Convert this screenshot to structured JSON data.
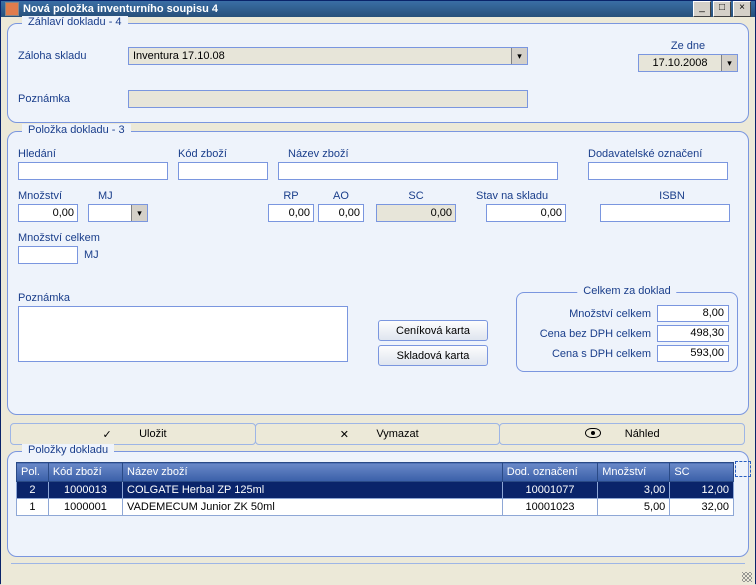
{
  "window": {
    "title": "Nová položka inventurního soupisu 4"
  },
  "header": {
    "legend": "Záhlaví dokladu - 4",
    "storageBackupLabel": "Záloha skladu",
    "storageBackupValue": "Inventura 17.10.08",
    "dateLabel": "Ze dne",
    "dateValue": "17.10.2008",
    "noteLabel": "Poznámka",
    "noteValue": ""
  },
  "item": {
    "legend": "Položka dokladu - 3",
    "searchLabel": "Hledání",
    "searchValue": "",
    "codeLabel": "Kód zboží",
    "codeValue": "",
    "nameLabel": "Název zboží",
    "nameValue": "",
    "supplierLabel": "Dodavatelské označení",
    "supplierValue": "",
    "qtyLabel": "Množství",
    "qtyValue": "0,00",
    "mjLabel": "MJ",
    "mjValue": "",
    "rpLabel": "RP",
    "rpValue": "0,00",
    "aoLabel": "AO",
    "aoValue": "0,00",
    "scLabel": "SC",
    "scValue": "0,00",
    "stockLabel": "Stav na skladu",
    "stockValue": "0,00",
    "isbnLabel": "ISBN",
    "isbnValue": "",
    "qtyTotalLabel": "Množství celkem",
    "qtyTotalValue": "",
    "qtyTotalMj": "MJ",
    "noteLabel": "Poznámka",
    "noteValue": "",
    "priceCardBtn": "Ceníková karta",
    "stockCardBtn": "Skladová karta",
    "totals": {
      "legend": "Celkem za doklad",
      "qtyLabel": "Množství celkem",
      "qtyValue": "8,00",
      "priceExLabel": "Cena bez DPH celkem",
      "priceExValue": "498,30",
      "priceIncLabel": "Cena s DPH celkem",
      "priceIncValue": "593,00"
    }
  },
  "actions": {
    "save": "Uložit",
    "clear": "Vymazat",
    "preview": "Náhled"
  },
  "items": {
    "legend": "Položky dokladu",
    "columns": {
      "pol": "Pol.",
      "code": "Kód zboží",
      "name": "Název zboží",
      "supplier": "Dod. označení",
      "qty": "Množství",
      "sc": "SC"
    },
    "rows": [
      {
        "pol": "2",
        "code": "1000013",
        "name": "COLGATE Herbal ZP 125ml",
        "supplier": "10001077",
        "qty": "3,00",
        "sc": "12,00",
        "selected": true
      },
      {
        "pol": "1",
        "code": "1000001",
        "name": "VADEMECUM Junior ZK 50ml",
        "supplier": "10001023",
        "qty": "5,00",
        "sc": "32,00",
        "selected": false
      }
    ]
  }
}
